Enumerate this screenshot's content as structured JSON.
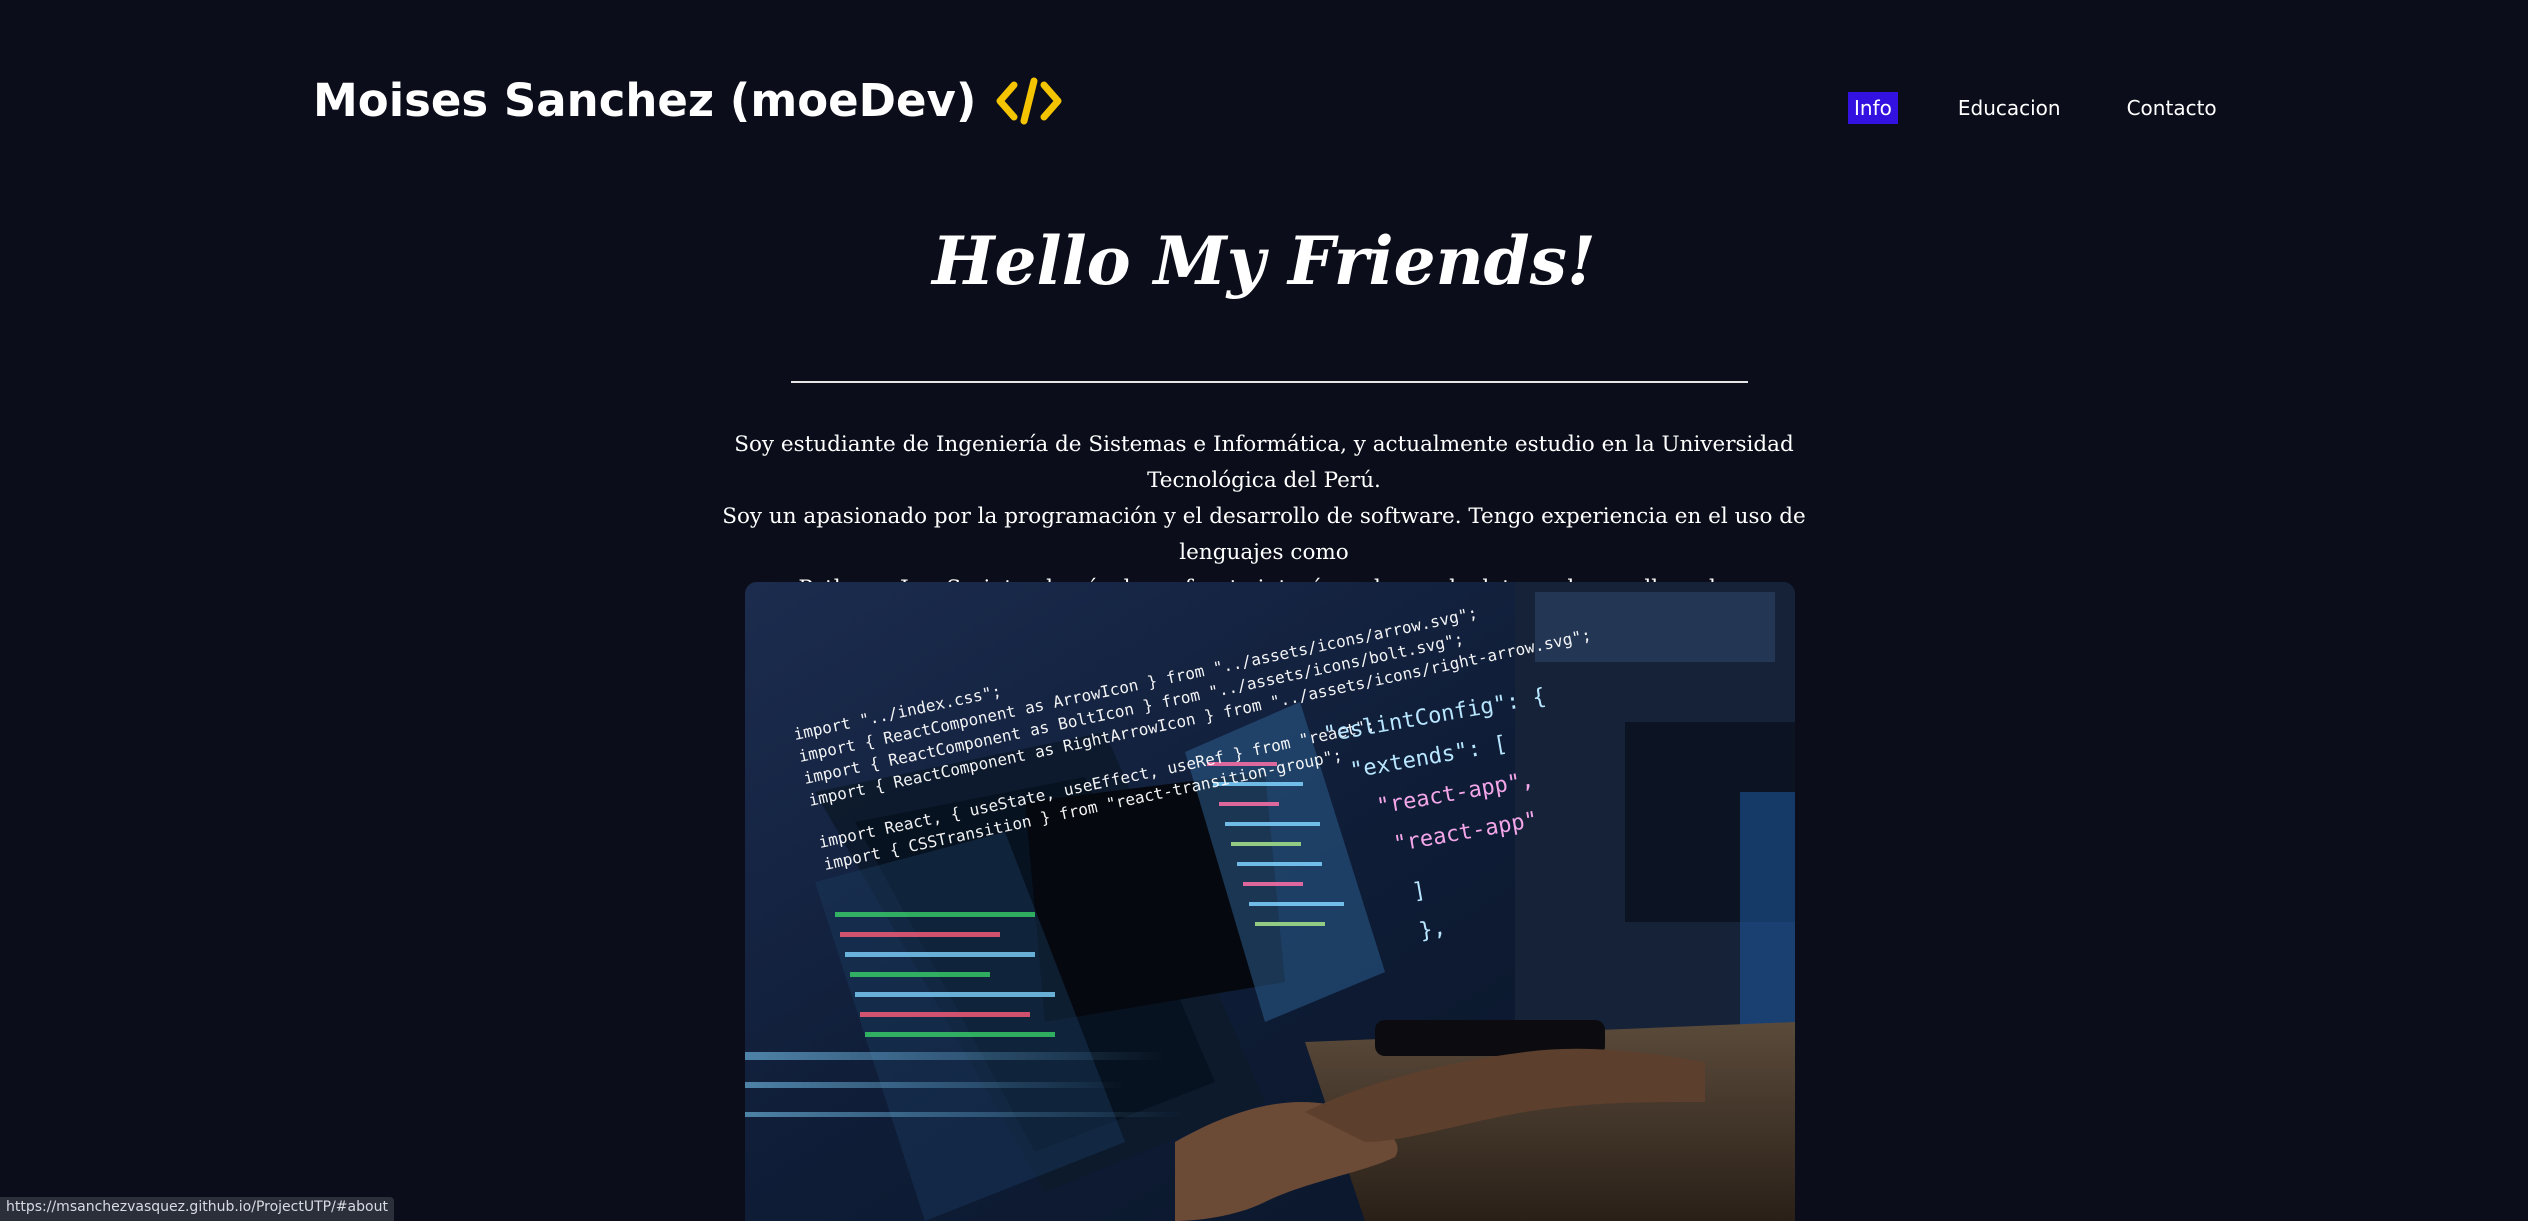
{
  "header": {
    "brand": "Moises Sanchez (moeDev)",
    "brand_icon": "code-brackets-icon",
    "accent_color": "#f5c400"
  },
  "nav": {
    "items": [
      {
        "label": "Info",
        "active": true
      },
      {
        "label": "Educacion",
        "active": false
      },
      {
        "label": "Contacto",
        "active": false
      }
    ],
    "active_color": "#3311e0"
  },
  "hero": {
    "title": "Hello My Friends!",
    "intro_lines": [
      "Soy estudiante de Ingeniería de Sistemas e Informática, y actualmente estudio en la Universidad Tecnológica del Perú.",
      "Soy un apasionado por la programación y el desarrollo de software. Tengo experiencia en el uso de lenguajes como",
      "Python y JavaScript, además de un fuerte interés en bases de datos y desarrollo web."
    ]
  },
  "photo": {
    "code_lines": [
      "import \"../index.css\";",
      "import { ReactComponent as ArrowIcon } from \"../assets/icons/arrow.svg\";",
      "import { ReactComponent as BoltIcon } from \"../assets/icons/bolt.svg\";",
      "import { ReactComponent as RightArrowIcon } from \"../assets/icons/right-arrow.svg\";",
      "import React, { useState, useEffect, useRef } from \"react\";",
      "import { CSSTransition } from \"react-transition-group\";"
    ],
    "config_lines": [
      "\"eslintConfig\": {",
      "\"extends\": [",
      "\"react-app\",",
      "\"react-app\"",
      "]",
      "},"
    ]
  },
  "status_bar": {
    "url": "https://msanchezvasquez.github.io/ProjectUTP/#about"
  }
}
